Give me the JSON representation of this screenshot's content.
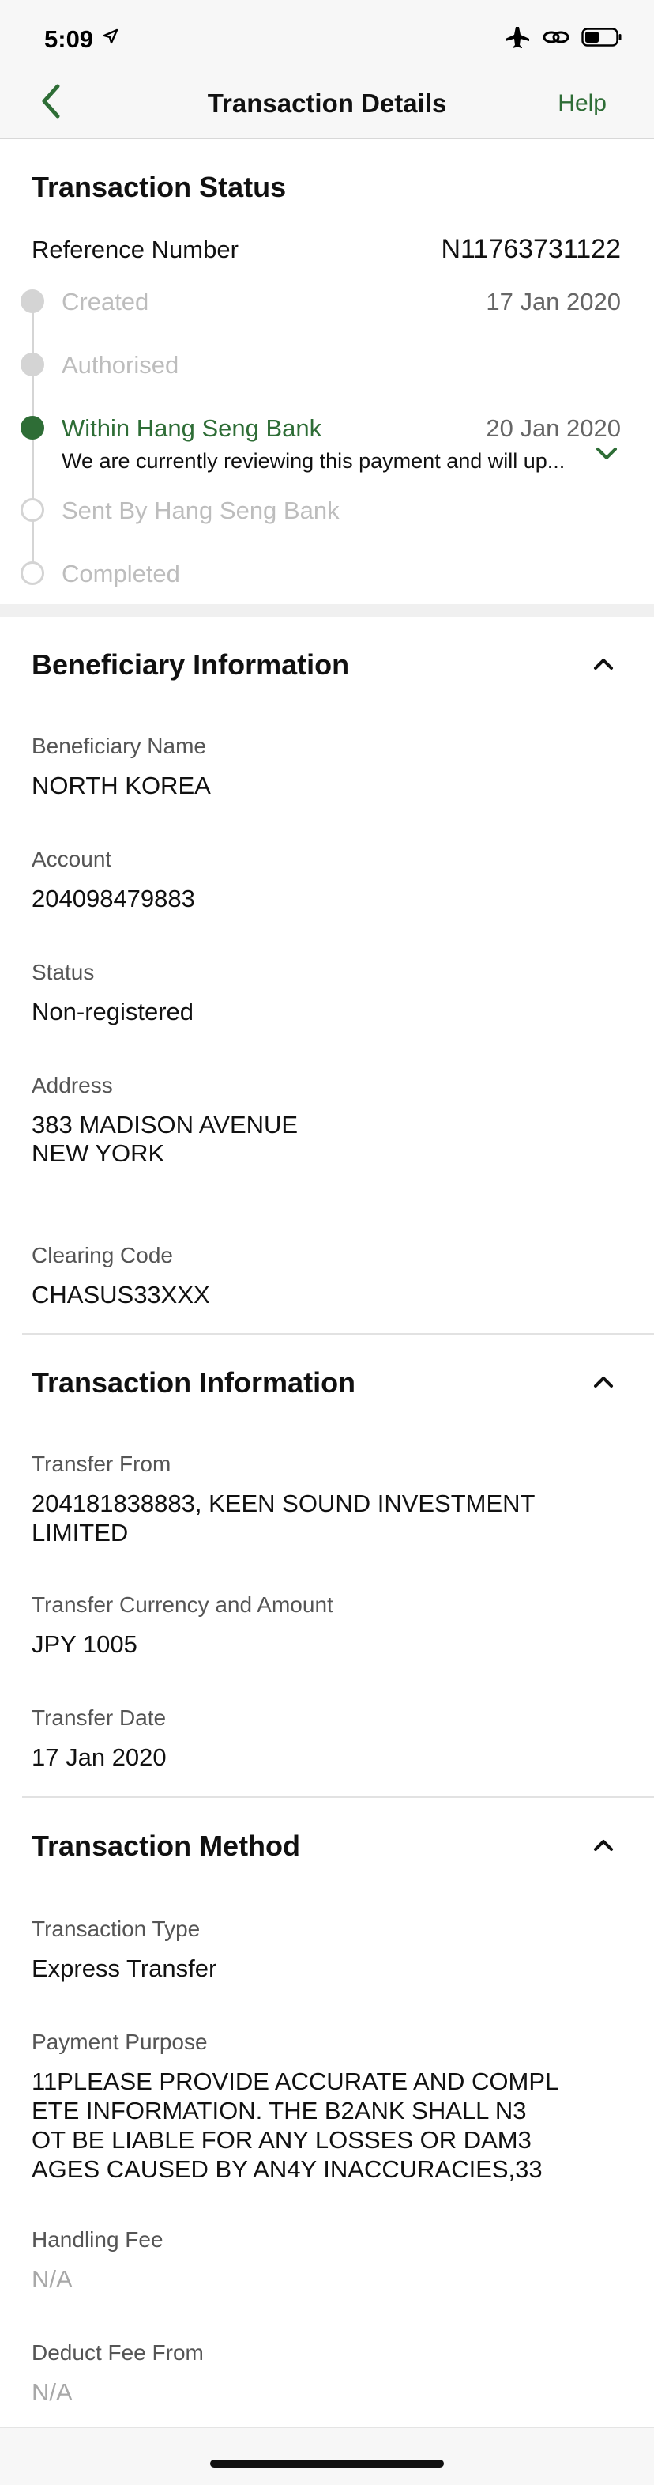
{
  "status_bar": {
    "time": "5:09",
    "icons": [
      "location-arrow-icon",
      "airplane-icon",
      "link-icon",
      "battery-icon"
    ]
  },
  "nav": {
    "back_icon": "chevron-left-icon",
    "title": "Transaction Details",
    "help_label": "Help",
    "accent_color": "#2e6d36"
  },
  "transaction_status": {
    "heading": "Transaction Status",
    "reference_label": "Reference Number",
    "reference_value": "N11763731122",
    "steps": [
      {
        "label": "Created",
        "date": "17 Jan 2020",
        "state": "done"
      },
      {
        "label": "Authorised",
        "date": "",
        "state": "done"
      },
      {
        "label": "Within Hang Seng Bank",
        "date": "20 Jan 2020",
        "state": "current",
        "description": "We are currently reviewing this payment and will up..."
      },
      {
        "label": "Sent By Hang Seng Bank",
        "date": "",
        "state": "pending"
      },
      {
        "label": "Completed",
        "date": "",
        "state": "pending"
      }
    ]
  },
  "beneficiary": {
    "heading": "Beneficiary Information",
    "fields": {
      "name_label": "Beneficiary Name",
      "name_value": "NORTH KOREA",
      "account_label": "Account",
      "account_value": "204098479883",
      "status_label": "Status",
      "status_value": "Non-registered",
      "address_label": "Address",
      "address_line1": "383 MADISON AVENUE",
      "address_line2": "NEW YORK",
      "clearing_label": "Clearing Code",
      "clearing_value": "CHASUS33XXX"
    }
  },
  "transaction_info": {
    "heading": "Transaction Information",
    "fields": {
      "from_label": "Transfer From",
      "from_value": "204181838883, KEEN SOUND INVESTMENT LIMITED",
      "amount_label": "Transfer Currency and Amount",
      "amount_value": "JPY 1005",
      "date_label": "Transfer Date",
      "date_value": "17 Jan 2020"
    }
  },
  "transaction_method": {
    "heading": "Transaction Method",
    "fields": {
      "type_label": "Transaction Type",
      "type_value": "Express Transfer",
      "purpose_label": "Payment Purpose",
      "purpose_line1": "11PLEASE PROVIDE ACCURATE AND COMPL",
      "purpose_line2": "ETE INFORMATION. THE B2ANK SHALL N3",
      "purpose_line3": "OT BE LIABLE FOR ANY LOSSES OR DAM3",
      "purpose_line4": "AGES CAUSED BY AN4Y INACCURACIES,33",
      "fee_label": "Handling Fee",
      "fee_value": "N/A",
      "deduct_label": "Deduct Fee From",
      "deduct_value": "N/A"
    }
  }
}
